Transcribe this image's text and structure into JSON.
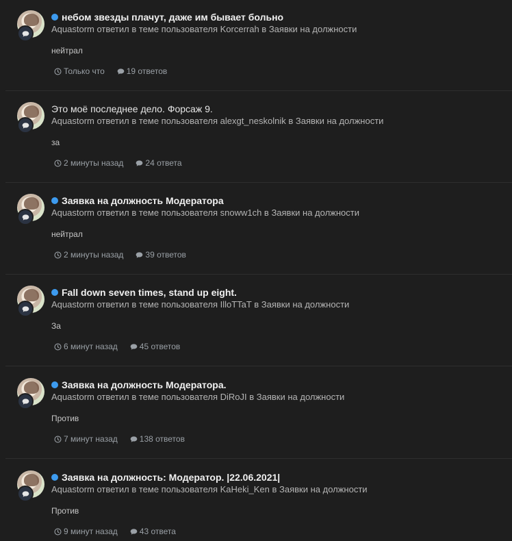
{
  "feed": {
    "items": [
      {
        "title": "небом звезды плачут, даже им бывает больно",
        "unread": true,
        "meta": "Aquastorm ответил в теме пользователя Korcerrah в Заявки на должности",
        "snippet": "нейтрал",
        "time": "Только что",
        "replies": "19 ответов"
      },
      {
        "title": "Это моё последнее дело. Форсаж 9.",
        "unread": false,
        "meta": "Aquastorm ответил в теме пользователя alexgt_neskolnik в Заявки на должности",
        "snippet": "за",
        "time": "2 минуты назад",
        "replies": "24 ответа"
      },
      {
        "title": "Заявка на должность Модератора",
        "unread": true,
        "meta": "Aquastorm ответил в теме пользователя snoww1ch в Заявки на должности",
        "snippet": "нейтрал",
        "time": "2 минуты назад",
        "replies": "39 ответов"
      },
      {
        "title": "Fall down seven times, stand up eight.",
        "unread": true,
        "meta": "Aquastorm ответил в теме пользователя IlloTTaT в Заявки на должности",
        "snippet": "За",
        "time": "6 минут назад",
        "replies": "45 ответов"
      },
      {
        "title": "Заявка на должность Модератора.",
        "unread": true,
        "meta": "Aquastorm ответил в теме пользователя DiRoJI в Заявки на должности",
        "snippet": "Против",
        "time": "7 минут назад",
        "replies": "138 ответов"
      },
      {
        "title": "Заявка на должность: Модератор. |22.06.2021|",
        "unread": true,
        "meta": "Aquastorm ответил в теме пользователя KaHeki_Ken в Заявки на должности",
        "snippet": "Против",
        "time": "9 минут назад",
        "replies": "43 ответа"
      }
    ]
  },
  "icons": {
    "unread": "unread-dot-icon",
    "badge": "comment-icon",
    "time": "clock-icon",
    "replies": "comment-icon"
  },
  "colors": {
    "background": "#1e1e1e",
    "unread_dot": "#3d9bef",
    "badge_bg": "#2b3342"
  }
}
